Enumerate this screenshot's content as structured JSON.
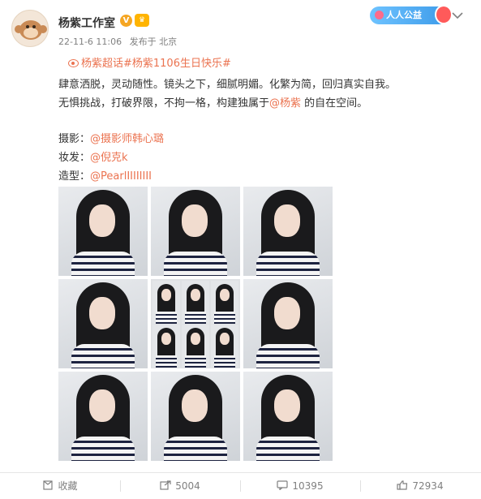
{
  "user": {
    "name": "杨紫工作室",
    "verified_mark": "V",
    "level_mark": "♛",
    "timestamp": "22-11-6 11:06",
    "source": "发布于 北京",
    "charity_badge": "人人公益"
  },
  "post": {
    "topics": "杨紫超话#杨紫1106生日快乐#",
    "line1": "肆意洒脱，灵动随性。镜头之下，细腻明媚。化繁为简，回归真实自我。",
    "line2_prefix": "无惧挑战，打破界限，不拘一格，构建独属于",
    "line2_mention": "@杨紫",
    "line2_suffix": " 的自在空间。",
    "photo_label": "摄影：",
    "photo_mention": "@摄影师韩心璐",
    "makeup_label": "妆发：",
    "makeup_mention": "@倪克k",
    "styling_label": "造型：",
    "styling_mention": "@PearlIIIIIIII"
  },
  "actions": {
    "favorite": "收藏",
    "repost": "5004",
    "comment": "10395",
    "like": "72934"
  },
  "colors": {
    "link": "#eb7350",
    "text": "#333333",
    "meta": "#808080"
  }
}
